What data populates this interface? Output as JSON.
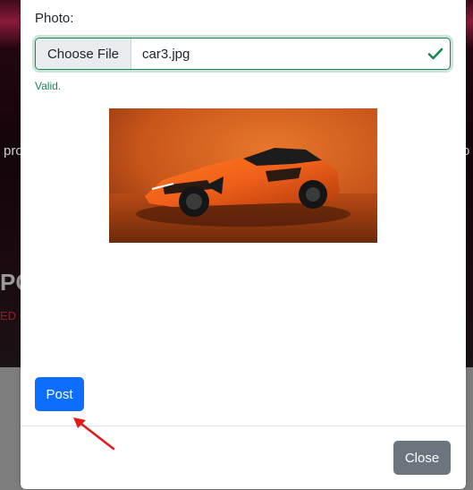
{
  "backdrop": {
    "fragment_left": "pro",
    "fragment_right": "o",
    "fragment_heading": "PO",
    "fragment_red": "ED C"
  },
  "modal": {
    "photo_label": "Photo:",
    "file_input": {
      "button_label": "Choose File",
      "file_name": "car3.jpg",
      "valid_icon": "check-icon"
    },
    "valid_message": "Valid.",
    "preview_image": "orange-sports-car-photo",
    "post_button": "Post",
    "close_button": "Close"
  },
  "annotation": {
    "arrow_icon": "red-arrow-pointing-to-post"
  },
  "colors": {
    "primary": "#0d6efd",
    "secondary": "#6c757d",
    "success": "#198754",
    "annotation": "#e31b1b"
  }
}
